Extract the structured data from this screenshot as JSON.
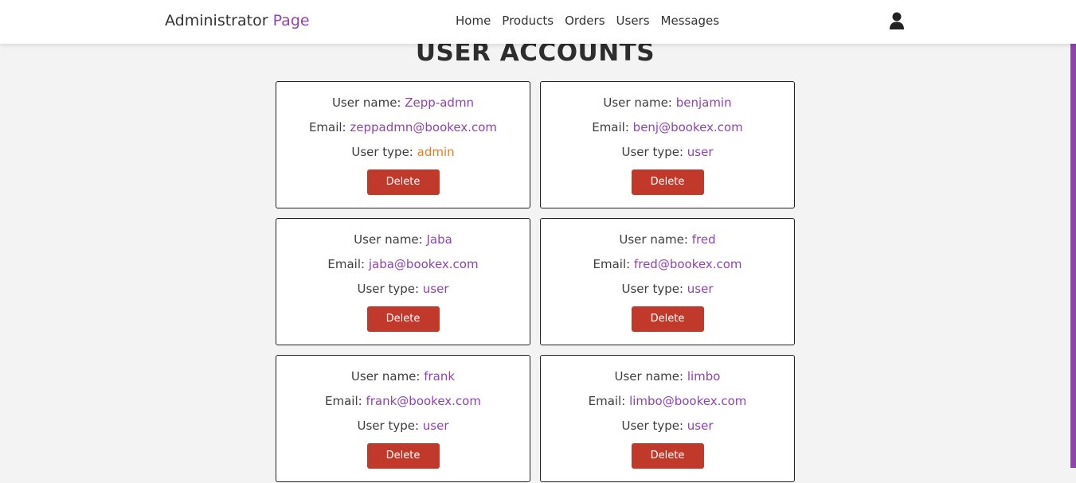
{
  "header": {
    "logo_main": "Administrator",
    "logo_accent": "Page",
    "nav": [
      "Home",
      "Products",
      "Orders",
      "Users",
      "Messages"
    ]
  },
  "page_title": "USER ACCOUNTS",
  "labels": {
    "user_name": "User name: ",
    "email": "Email: ",
    "user_type": "User type: ",
    "delete": "Delete"
  },
  "users": [
    {
      "name": "Zepp-admn",
      "email": "zeppadmn@bookex.com",
      "type": "admin"
    },
    {
      "name": "benjamin",
      "email": "benj@bookex.com",
      "type": "user"
    },
    {
      "name": "Jaba",
      "email": "jaba@bookex.com",
      "type": "user"
    },
    {
      "name": "fred",
      "email": "fred@bookex.com",
      "type": "user"
    },
    {
      "name": "frank",
      "email": "frank@bookex.com",
      "type": "user"
    },
    {
      "name": "limbo",
      "email": "limbo@bookex.com",
      "type": "user"
    }
  ],
  "colors": {
    "accent": "#8e44ad",
    "admin": "#e67e22",
    "delete_button": "#c0392b"
  }
}
